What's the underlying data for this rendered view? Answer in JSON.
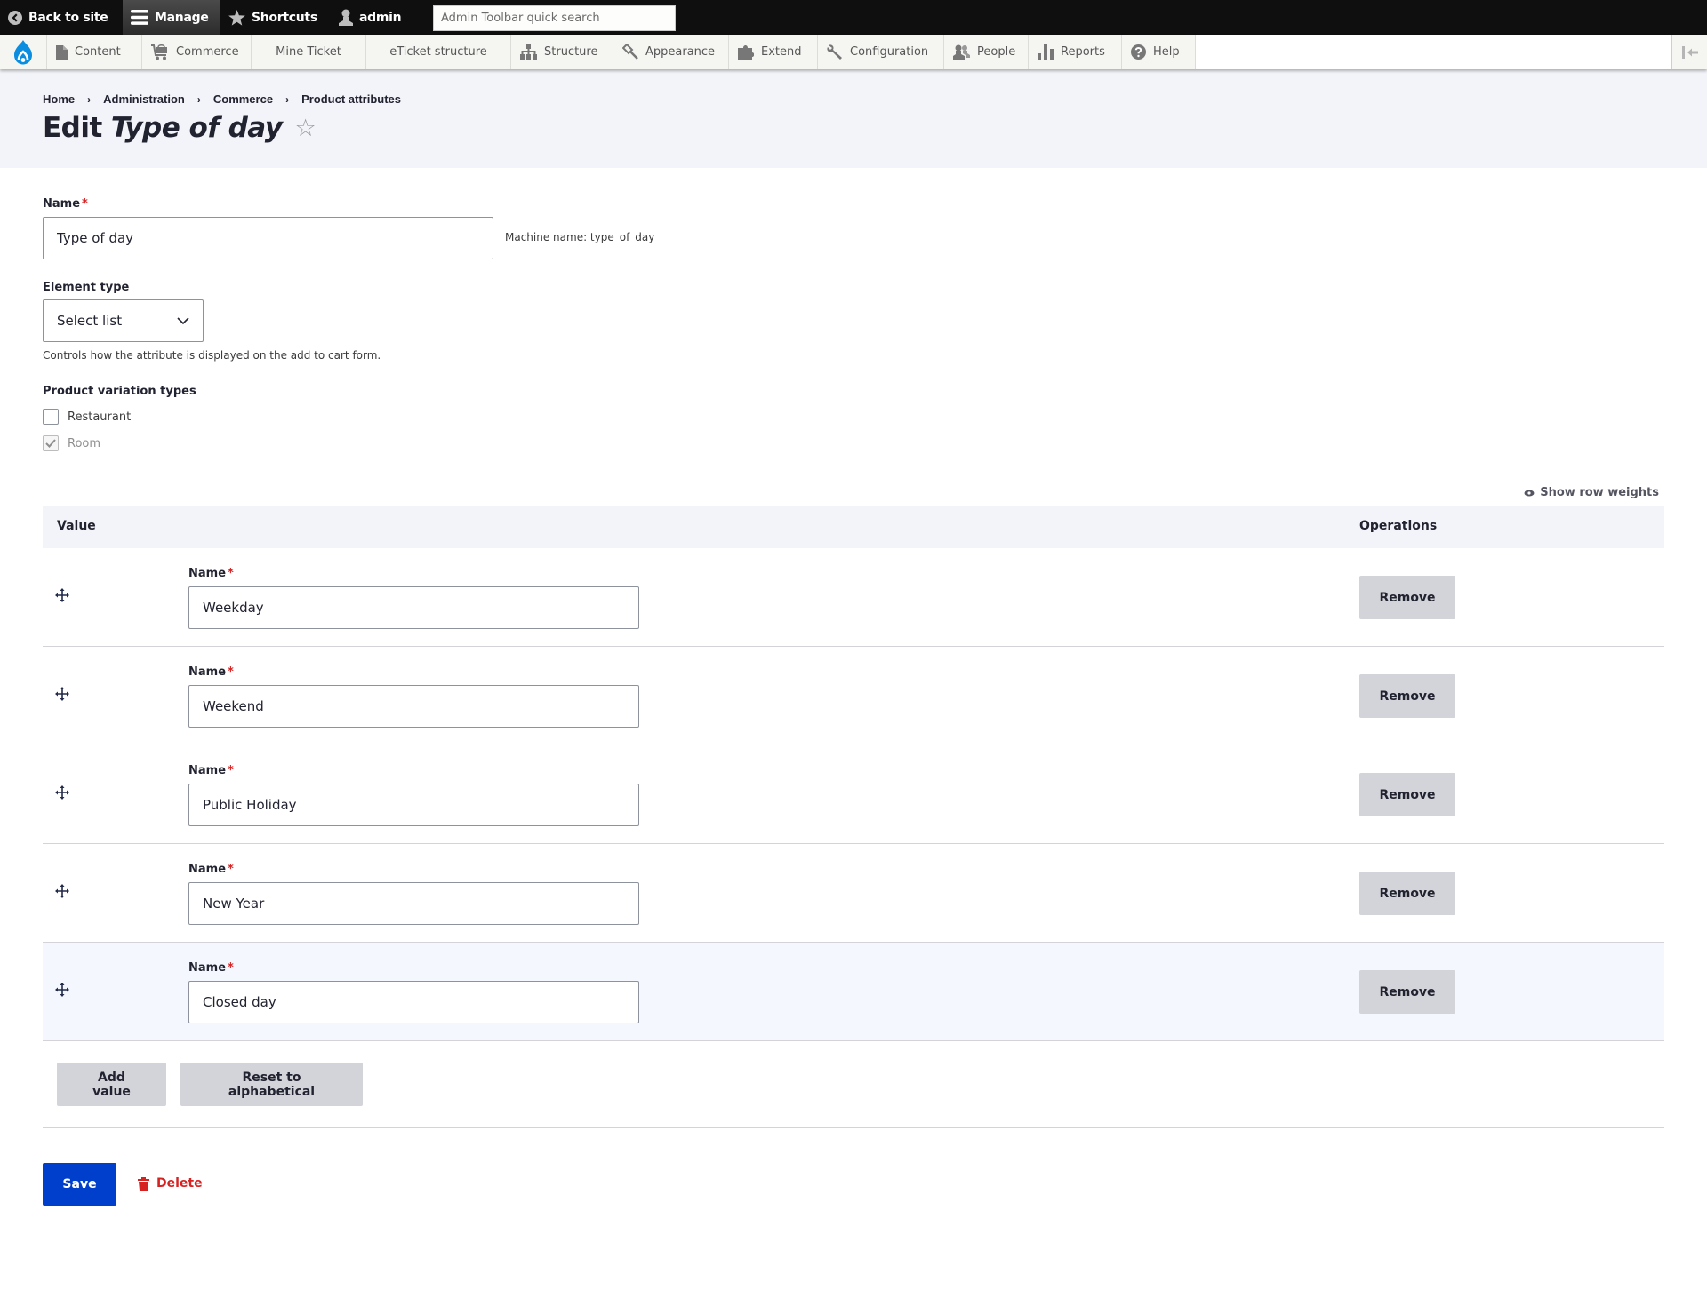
{
  "toolbar": {
    "back_to_site": "Back to site",
    "manage": "Manage",
    "shortcuts": "Shortcuts",
    "user": "admin",
    "search_placeholder": "Admin Toolbar quick search",
    "search_value": ""
  },
  "tray": {
    "logo": "drupal-logo",
    "items": [
      {
        "label": "Content",
        "icon": "file-icon"
      },
      {
        "label": "Commerce",
        "icon": "cart-icon"
      },
      {
        "label": "Mine Ticket",
        "icon": null
      },
      {
        "label": "eTicket structure",
        "icon": null
      },
      {
        "label": "Structure",
        "icon": "sitemap-icon"
      },
      {
        "label": "Appearance",
        "icon": "paintbrush-icon"
      },
      {
        "label": "Extend",
        "icon": "puzzle-icon"
      },
      {
        "label": "Configuration",
        "icon": "wrench-icon"
      },
      {
        "label": "People",
        "icon": "people-icon"
      },
      {
        "label": "Reports",
        "icon": "bar-chart-icon"
      },
      {
        "label": "Help",
        "icon": "help-icon"
      }
    ],
    "toggle_orientation": "collapse-tray"
  },
  "breadcrumb": [
    "Home",
    "Administration",
    "Commerce",
    "Product attributes"
  ],
  "breadcrumb_separator": "›",
  "page": {
    "title_prefix": "Edit",
    "title_entity": "Type of day",
    "favorite_star": "☆"
  },
  "form": {
    "name_label": "Name",
    "required_marker": "*",
    "name_value": "Type of day",
    "machine_name": "Machine name: type_of_day",
    "element_type_label": "Element type",
    "element_type_value": "Select list",
    "element_type_help": "Controls how the attribute is displayed on the add to cart form.",
    "variation_types_label": "Product variation types",
    "variation_types": [
      {
        "label": "Restaurant",
        "checked": false,
        "disabled": false
      },
      {
        "label": "Room",
        "checked": true,
        "disabled": true
      }
    ]
  },
  "table": {
    "show_row_weights": "Show row weights",
    "columns": {
      "value": "Value",
      "operations": "Operations"
    },
    "row_field_label": "Name",
    "remove_label": "Remove",
    "rows": [
      {
        "name": "Weekday",
        "highlighted": false
      },
      {
        "name": "Weekend",
        "highlighted": false
      },
      {
        "name": "Public Holiday",
        "highlighted": false
      },
      {
        "name": "New Year",
        "highlighted": false
      },
      {
        "name": "Closed day",
        "highlighted": true
      }
    ]
  },
  "actions": {
    "add_value": "Add value",
    "reset_alphabetical": "Reset to alphabetical",
    "save": "Save",
    "delete": "Delete"
  },
  "colors": {
    "primary": "#003ecc",
    "danger": "#d72222",
    "header_bg": "#f3f4f9",
    "toolbar_bg": "#0f0f0f",
    "drupal_blue": "#0c8ee0"
  }
}
